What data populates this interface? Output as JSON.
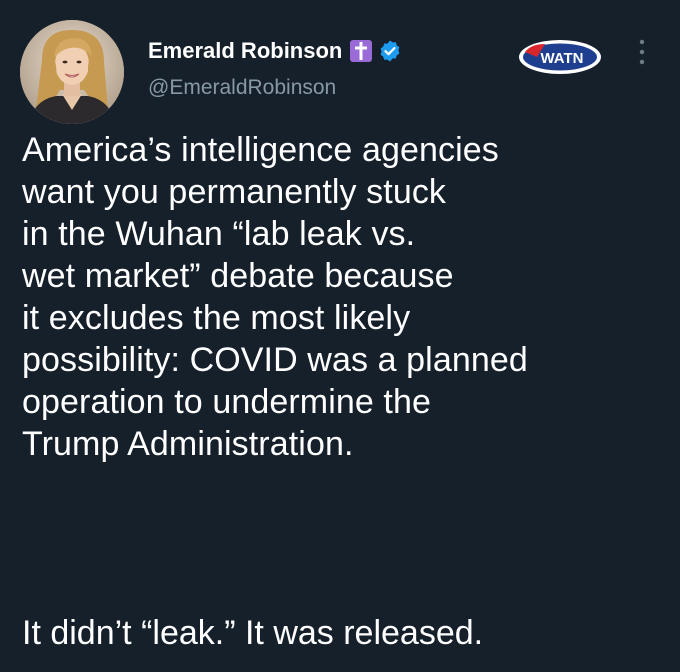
{
  "author": {
    "display_name": "Emerald Robinson",
    "handle": "@EmeraldRobinson",
    "badge_icon": "latin-cross-icon",
    "verified_icon": "verified-badge-icon",
    "affiliate_logo_text": "WATN"
  },
  "tweet": {
    "lines": [
      "America’s intelligence agencies",
      "want you permanently stuck",
      "in the Wuhan “lab leak vs.",
      "wet market” debate because",
      "it excludes the most likely",
      "possibility: COVID was a planned",
      "operation to undermine the",
      "Trump Administration."
    ],
    "final_line": "It didn’t “leak.” It was released."
  },
  "colors": {
    "background": "#15202b",
    "text_primary": "#ffffff",
    "text_secondary": "#8899a6",
    "verified_blue": "#1d9bf0",
    "cross_badge": "#9a6bd6",
    "logo_red": "#d8262c",
    "logo_blue": "#1e3f8f"
  }
}
